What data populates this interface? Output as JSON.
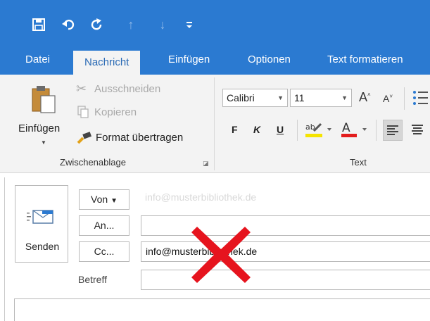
{
  "quick_access": {
    "save_icon": "save-icon",
    "undo_icon": "undo-icon",
    "redo_icon": "redo-icon",
    "up_icon": "arrow-up-icon",
    "down_icon": "arrow-down-icon",
    "customize_icon": "customize-icon"
  },
  "tabs": [
    {
      "label": "Datei"
    },
    {
      "label": "Nachricht"
    },
    {
      "label": "Einfügen"
    },
    {
      "label": "Optionen"
    },
    {
      "label": "Text formatieren"
    }
  ],
  "clipboard": {
    "paste_label": "Einfügen",
    "cut_label": "Ausschneiden",
    "copy_label": "Kopieren",
    "format_painter_label": "Format übertragen",
    "group_label": "Zwischenablage"
  },
  "text_group": {
    "font_name": "Calibri",
    "font_size": "11",
    "bold": "F",
    "italic": "K",
    "underline": "U",
    "group_label": "Text"
  },
  "compose": {
    "send_label": "Senden",
    "from_button": "Von",
    "to_button": "An...",
    "cc_button": "Cc...",
    "subject_label": "Betreff",
    "from_value": "info@musterbibliothek.de",
    "to_value": "",
    "cc_value": "info@musterbibliothek.de",
    "subject_value": ""
  },
  "colors": {
    "accent": "#2b7ad1",
    "ribbon_bg": "#f3f3f3",
    "red_mark": "#e6141e"
  }
}
